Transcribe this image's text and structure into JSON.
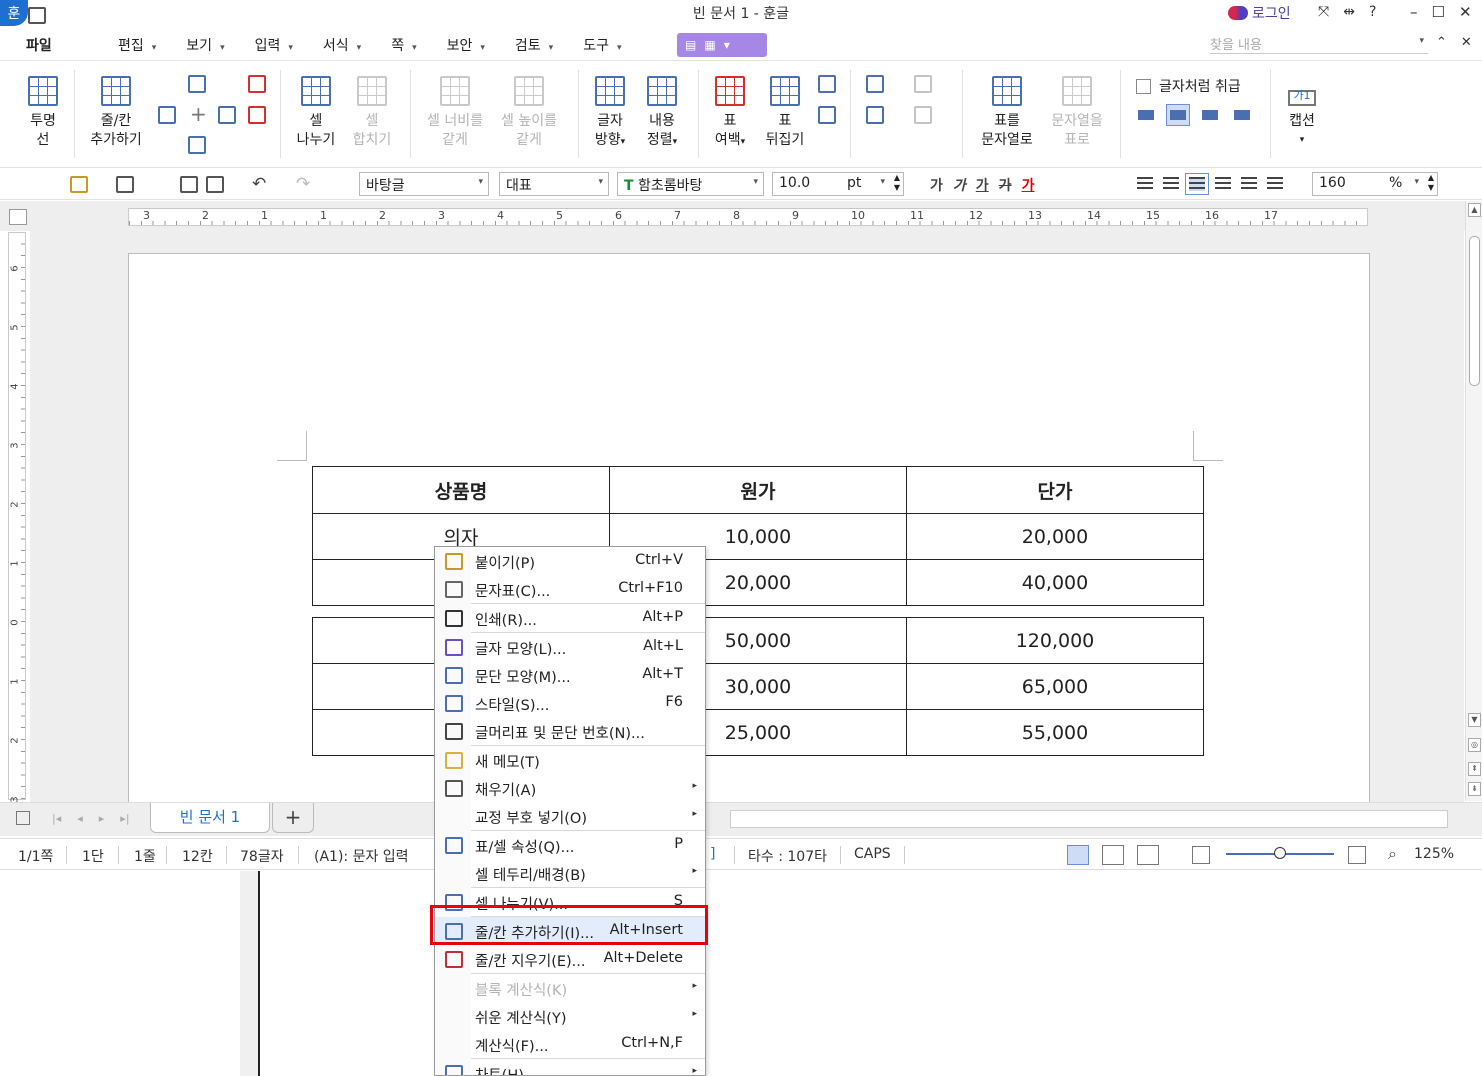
{
  "app": {
    "logo_glyph": "훈",
    "title": "빈 문서 1 - 훈글",
    "login_label": "로그인",
    "title_icons": [
      "⤧",
      "⇹",
      "?"
    ],
    "window_controls": [
      "–",
      "☐",
      "✕"
    ]
  },
  "menubar": {
    "file": "파일",
    "items": [
      "편집",
      "보기",
      "입력",
      "서식",
      "쪽",
      "보안",
      "검토",
      "도구"
    ],
    "search_placeholder": "찾을 내용",
    "right_icons": [
      "⌃",
      "✕"
    ]
  },
  "ribbon": {
    "buttons": [
      {
        "label1": "투명",
        "label2": "선"
      },
      {
        "label1": "줄/칸",
        "label2": "추가하기"
      },
      {
        "label1": "셀",
        "label2": "나누기"
      },
      {
        "label1": "셀",
        "label2": "합치기"
      },
      {
        "label1": "셀 너비를",
        "label2": "같게"
      },
      {
        "label1": "셀 높이를",
        "label2": "같게"
      },
      {
        "label1": "글자",
        "label2": "방향"
      },
      {
        "label1": "내용",
        "label2": "정렬"
      },
      {
        "label1": "표",
        "label2": "여백"
      },
      {
        "label1": "표",
        "label2": "뒤집기"
      },
      {
        "label1": "표를",
        "label2": "문자열로"
      },
      {
        "label1": "문자열을",
        "label2": "표로"
      },
      {
        "label1": "캡션",
        "label2": ""
      }
    ],
    "treat_as_char": "글자처럼 취급",
    "caption_tag": "가1"
  },
  "toolbar2": {
    "style_combo": "바탕글",
    "lang_combo": "대표",
    "font_combo": "함초롬바탕",
    "font_icon": "T",
    "size_value": "10.0",
    "size_unit": "pt",
    "format_buttons": [
      "가",
      "가",
      "가",
      "가",
      "가"
    ],
    "zoom_value": "160",
    "zoom_unit": "%"
  },
  "ruler": {
    "h_numbers": [
      "3",
      "2",
      "1",
      "1",
      "2",
      "3",
      "4",
      "5",
      "6",
      "7",
      "8",
      "9",
      "10",
      "11",
      "12",
      "13",
      "14",
      "15",
      "16",
      "17"
    ],
    "v_numbers": [
      "6",
      "5",
      "4",
      "3",
      "2",
      "1",
      "0",
      "1",
      "2",
      "3"
    ]
  },
  "document": {
    "table1": {
      "header": [
        "상품명",
        "원가",
        "단가"
      ],
      "rows": [
        [
          "의자",
          "10,000",
          "20,000"
        ],
        [
          "",
          "20,000",
          "40,000"
        ]
      ]
    },
    "table2": {
      "rows": [
        [
          "",
          "50,000",
          "120,000"
        ],
        [
          "",
          "30,000",
          "65,000"
        ],
        [
          "",
          "25,000",
          "55,000"
        ]
      ]
    }
  },
  "tabs": {
    "doc_tab": "빈 문서 1",
    "add_tab": "+",
    "nav": [
      "|◂",
      "◂",
      "▸",
      "▸|"
    ]
  },
  "status": {
    "page": "1/1쪽",
    "column": "1단",
    "line": "1줄",
    "col_pos": "12칸",
    "chars": "78글자",
    "cell": "(A1): 문자 입력",
    "partial": "]",
    "typing_speed": "타수 : 107타",
    "caps": "CAPS",
    "zoom": "125%",
    "zoom_fraction": 0.5
  },
  "context_menu": {
    "items": [
      {
        "label": "붙이기(P)",
        "shortcut": "Ctrl+V",
        "arrow": "",
        "icon": "paste-icon"
      },
      {
        "label": "문자표(C)...",
        "shortcut": "Ctrl+F10",
        "arrow": "",
        "icon": "symbol-icon"
      },
      {
        "label": "인쇄(R)...",
        "shortcut": "Alt+P",
        "arrow": "",
        "icon": "print-icon"
      },
      {
        "label": "글자 모양(L)...",
        "shortcut": "Alt+L",
        "arrow": "",
        "icon": "char-shape-icon"
      },
      {
        "label": "문단 모양(M)...",
        "shortcut": "Alt+T",
        "arrow": "",
        "icon": "para-shape-icon"
      },
      {
        "label": "스타일(S)...",
        "shortcut": "F6",
        "arrow": "",
        "icon": "style-icon"
      },
      {
        "label": "글머리표 및 문단 번호(N)...",
        "shortcut": "",
        "arrow": "",
        "icon": "bullet-icon"
      },
      {
        "label": "새 메모(T)",
        "shortcut": "",
        "arrow": "",
        "icon": "memo-icon"
      },
      {
        "label": "채우기(A)",
        "shortcut": "",
        "arrow": "▸",
        "icon": "fill-icon"
      },
      {
        "label": "교정 부호 넣기(O)",
        "shortcut": "",
        "arrow": "▸",
        "icon": ""
      },
      {
        "label": "표/셀 속성(Q)...",
        "shortcut": "P",
        "arrow": "",
        "icon": "table-props-icon"
      },
      {
        "label": "셀 테두리/배경(B)",
        "shortcut": "",
        "arrow": "▸",
        "icon": ""
      },
      {
        "label": "셀 나누기(V)...",
        "shortcut": "S",
        "arrow": "",
        "icon": "split-cell-icon"
      },
      {
        "label": "줄/칸 추가하기(I)...",
        "shortcut": "Alt+Insert",
        "arrow": "",
        "icon": "insert-row-icon"
      },
      {
        "label": "줄/칸 지우기(E)...",
        "shortcut": "Alt+Delete",
        "arrow": "",
        "icon": "delete-row-icon"
      },
      {
        "label": "블록 계산식(K)",
        "shortcut": "",
        "arrow": "▸",
        "icon": ""
      },
      {
        "label": "쉬운 계산식(Y)",
        "shortcut": "",
        "arrow": "▸",
        "icon": ""
      },
      {
        "label": "계산식(F)...",
        "shortcut": "Ctrl+N,F",
        "arrow": "",
        "icon": ""
      },
      {
        "label": "차트(H)",
        "shortcut": "",
        "arrow": "▸",
        "icon": "chart-icon"
      }
    ]
  },
  "colors": {
    "accent": "#1f6fd1",
    "highlight_box": "#e8000f",
    "menu_ext": "#a687e6"
  }
}
